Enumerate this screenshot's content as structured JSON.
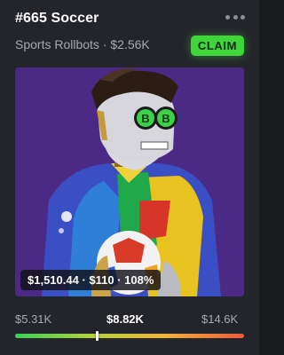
{
  "nft": {
    "title": "#665 Soccer",
    "subtitle": "Sports Rollbots · $2.56K",
    "claim_label": "CLAIM",
    "stats_text": "$1,510.44 · $110 · 108%"
  },
  "range": {
    "low": "$5.31K",
    "mid": "$8.82K",
    "high": "$14.6K",
    "position": 0.36
  },
  "colors": {
    "background": "#24252b",
    "claim": "#3fd53b",
    "art_background": "#4b2a86"
  },
  "icons": {
    "more": "more-horizontal-icon"
  }
}
